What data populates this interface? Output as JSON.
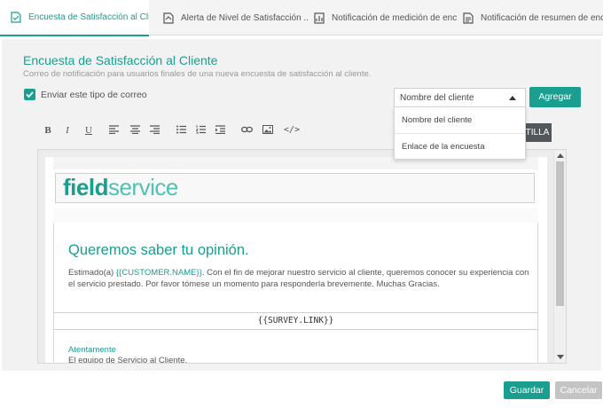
{
  "tabs": [
    {
      "label": "Encuesta de Satisfacción al Clie...",
      "icon": "survey-doc-icon",
      "active": true
    },
    {
      "label": "Alerta de Nivel de Satisfacción ...",
      "icon": "alert-doc-icon",
      "active": false
    },
    {
      "label": "Notificación de medición de enc...",
      "icon": "chart-doc-icon",
      "active": false
    },
    {
      "label": "Notificación de resumen de enc...",
      "icon": "summary-doc-icon",
      "active": false
    }
  ],
  "section": {
    "title": "Encuesta de Satisfacción al Cliente",
    "subtitle": "Correo de notificación para usuarios finales de una nueva encuesta de satisfacción al cliente."
  },
  "send_option": {
    "label": "Enviar este tipo de correo",
    "checked": true
  },
  "field_select": {
    "selected": "Nombre del cliente",
    "options": [
      "Nombre del cliente",
      "Enlace de la encuesta"
    ]
  },
  "add_button": "Agregar",
  "template_button": "TILLA",
  "toolbar": {
    "bold": "B",
    "italic": "I",
    "underline": "U",
    "code": "</>"
  },
  "email": {
    "logo_part1": "field",
    "logo_part2": "service",
    "heading": "Queremos saber tu opinión.",
    "greeting_prefix": "Estimado(a) ",
    "customer_token": "{{CUSTOMER.NAME}}",
    "body_rest": ". Con el fin de mejorar nuestro servicio al cliente, queremos conocer su experiencia con el servicio prestado. Por favor tómese un momento para responderla brevemente. Muchas Gracias.",
    "survey_link": "{{SURVEY.LINK}}",
    "closing": "Atentamente",
    "team": "El equipo de Servicio al Cliente."
  },
  "actions": {
    "save": "Guardar",
    "cancel": "Cancelar"
  },
  "colors": {
    "accent": "#1a9e8f",
    "dark_button": "#52575b",
    "disabled": "#c4c4c4"
  }
}
